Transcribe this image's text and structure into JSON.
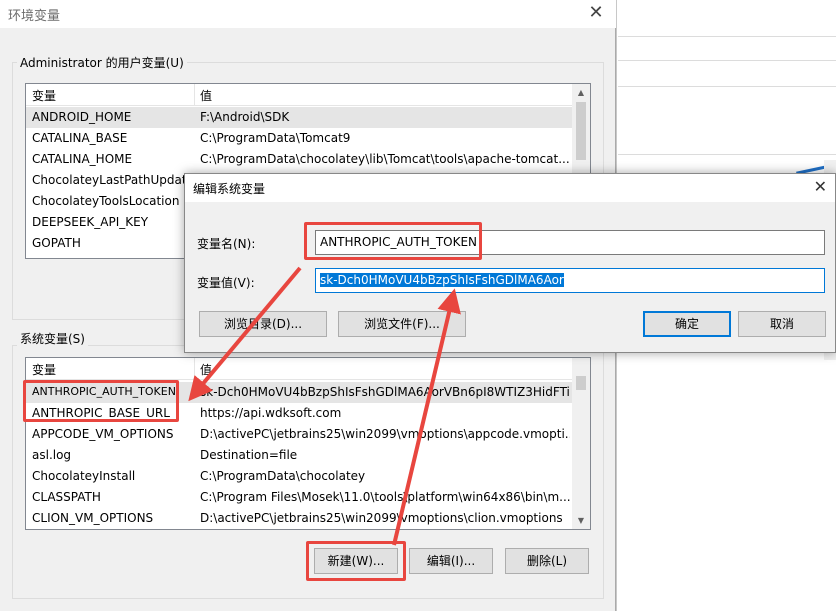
{
  "env_dialog": {
    "title": "环境变量",
    "user_group_label": "Administrator 的用户变量(U)",
    "system_group_label": "系统变量(S)",
    "col_name": "变量",
    "col_value": "值",
    "user_rows": [
      {
        "name": "ANDROID_HOME",
        "value": "F:\\Android\\SDK"
      },
      {
        "name": "CATALINA_BASE",
        "value": "C:\\ProgramData\\Tomcat9"
      },
      {
        "name": "CATALINA_HOME",
        "value": "C:\\ProgramData\\chocolatey\\lib\\Tomcat\\tools\\apache-tomcat..."
      },
      {
        "name": "ChocolateyLastPathUpdate",
        "value": ""
      },
      {
        "name": "ChocolateyToolsLocation",
        "value": ""
      },
      {
        "name": "DEEPSEEK_API_KEY",
        "value": ""
      },
      {
        "name": "GOPATH",
        "value": ""
      }
    ],
    "system_rows": [
      {
        "name": "ANTHROPIC_AUTH_TOKEN",
        "value": "sk-Dch0HMoVU4bBzpShIsFshGDlMA6AorVBn6pI8WTIZ3HidFTi"
      },
      {
        "name": "ANTHROPIC_BASE_URL",
        "value": "https://api.wdksoft.com"
      },
      {
        "name": "APPCODE_VM_OPTIONS",
        "value": "D:\\activePC\\jetbrains25\\win2099\\vmoptions\\appcode.vmopti..."
      },
      {
        "name": "asl.log",
        "value": "Destination=file"
      },
      {
        "name": "ChocolateyInstall",
        "value": "C:\\ProgramData\\chocolatey"
      },
      {
        "name": "CLASSPATH",
        "value": "C:\\Program Files\\Mosek\\11.0\\tools\\platform\\win64x86\\bin\\m..."
      },
      {
        "name": "CLION_VM_OPTIONS",
        "value": "D:\\activePC\\jetbrains25\\win2099\\vmoptions\\clion.vmoptions"
      }
    ],
    "btn_new": "新建(W)...",
    "btn_edit": "编辑(I)...",
    "btn_delete": "删除(L)"
  },
  "edit_dialog": {
    "title": "编辑系统变量",
    "name_label": "变量名(N):",
    "value_label": "变量值(V):",
    "name_value": "ANTHROPIC_AUTH_TOKEN",
    "value_value": "sk-Dch0HMoVU4bBzpShIsFshGDlMA6Aor",
    "btn_browse_dir": "浏览目录(D)...",
    "btn_browse_file": "浏览文件(F)...",
    "btn_ok": "确定",
    "btn_cancel": "取消"
  },
  "colors": {
    "annotation_red": "#e8463f",
    "selection_blue": "#0078d7"
  }
}
